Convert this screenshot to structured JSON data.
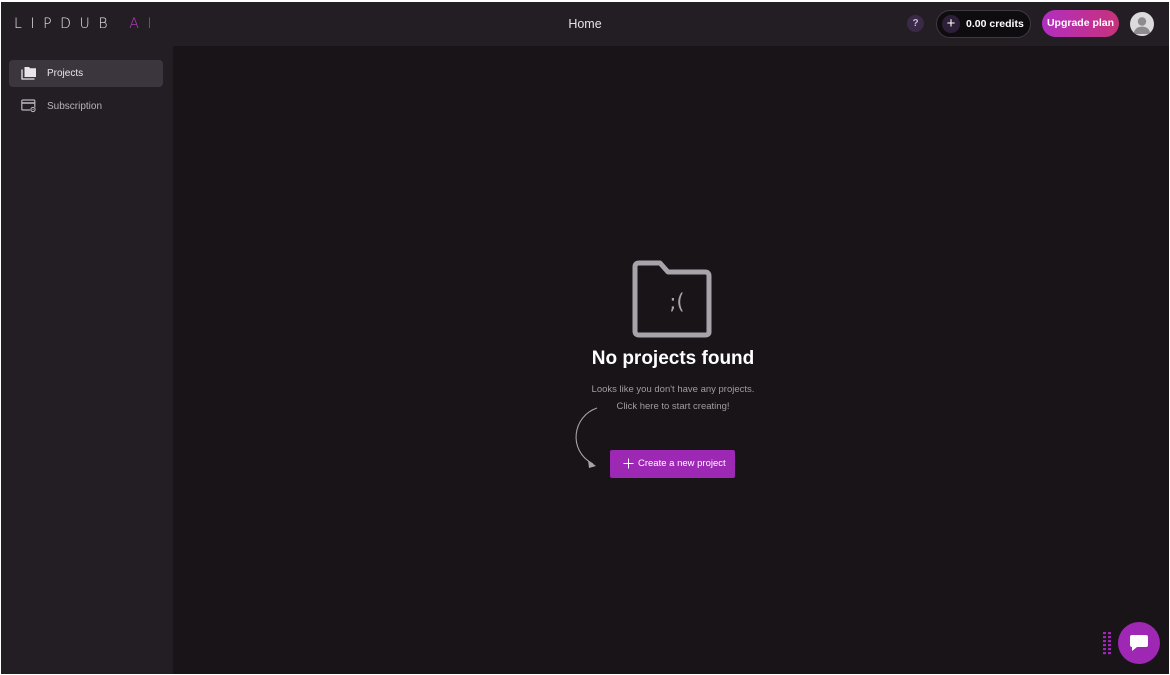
{
  "brand": {
    "logo_main": "LIPDUB ",
    "logo_accent": "AI",
    "accent_color": "#c23fd0"
  },
  "header": {
    "title": "Home",
    "help_label": "?",
    "credits_label": "0.00 credits",
    "credits_icon": "plus-icon",
    "upgrade_label": "Upgrade plan",
    "avatar_icon": "user-avatar-icon"
  },
  "sidebar": {
    "items": [
      {
        "label": "Projects",
        "icon": "folder-icon",
        "active": true
      },
      {
        "label": "Subscription",
        "icon": "billing-settings-icon",
        "active": false
      }
    ]
  },
  "empty_state": {
    "icon": "sad-folder-icon",
    "icon_text": ";(",
    "title": "No projects found",
    "line1": "Looks like you don't have any projects.",
    "line2": "Click here to start creating!",
    "button_label": "Create a new project",
    "button_color": "#9d28b3"
  },
  "chat_widget": {
    "icon": "chat-bubble-icon",
    "color": "#9e27b3"
  }
}
